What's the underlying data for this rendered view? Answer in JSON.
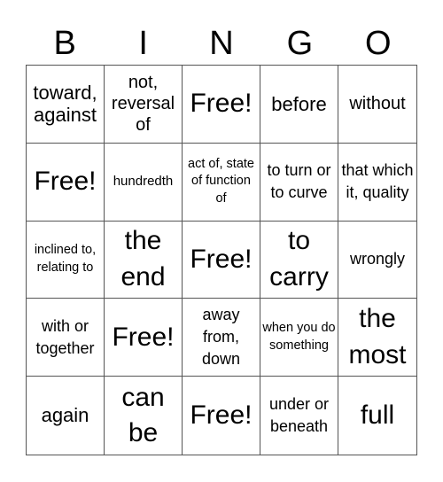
{
  "header": [
    "B",
    "I",
    "N",
    "G",
    "O"
  ],
  "cells": [
    {
      "text": "toward, against",
      "size": "s-lg"
    },
    {
      "text": "not, reversal of",
      "size": "s-md"
    },
    {
      "text": "Free!",
      "size": "s-free"
    },
    {
      "text": "before",
      "size": "s-lg"
    },
    {
      "text": "without",
      "size": "s-md"
    },
    {
      "text": "Free!",
      "size": "s-free"
    },
    {
      "text": "hundredth",
      "size": "s-xs"
    },
    {
      "text": "act of, state of function of",
      "size": "s-xxs"
    },
    {
      "text": "to turn or to curve",
      "size": "s-sm"
    },
    {
      "text": "that which it, quality",
      "size": "s-sm"
    },
    {
      "text": "inclined to, relating to",
      "size": "s-xxs"
    },
    {
      "text": "the end",
      "size": "s-xl"
    },
    {
      "text": "Free!",
      "size": "s-free"
    },
    {
      "text": "to carry",
      "size": "s-xl"
    },
    {
      "text": "wrongly",
      "size": "s-sm"
    },
    {
      "text": "with or together",
      "size": "s-sm"
    },
    {
      "text": "Free!",
      "size": "s-free"
    },
    {
      "text": "away from, down",
      "size": "s-sm"
    },
    {
      "text": "when you do something",
      "size": "s-xxs"
    },
    {
      "text": "the most",
      "size": "s-xl"
    },
    {
      "text": "again",
      "size": "s-lg"
    },
    {
      "text": "can be",
      "size": "s-xl"
    },
    {
      "text": "Free!",
      "size": "s-free"
    },
    {
      "text": "under or beneath",
      "size": "s-sm"
    },
    {
      "text": "full",
      "size": "s-xl"
    }
  ]
}
